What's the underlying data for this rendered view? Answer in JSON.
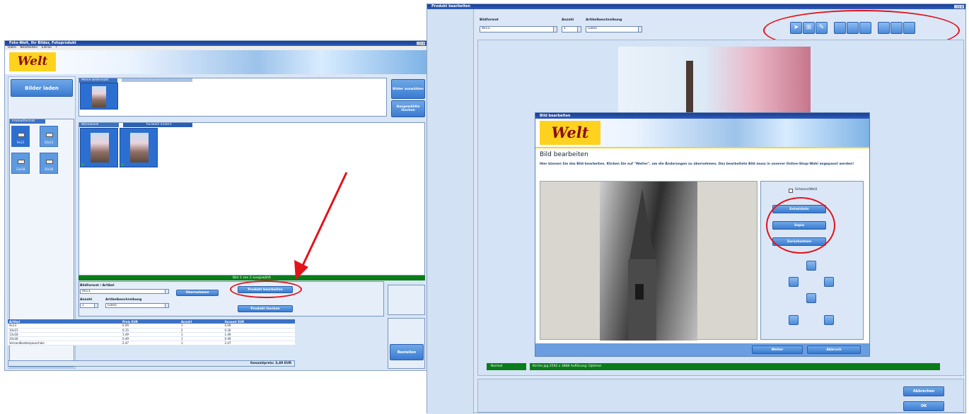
{
  "left_window": {
    "title": "Foto-Welt, Ihr Bilder, Fotoprodukt",
    "menu": [
      "Datei",
      "Bearbeiten",
      "Extras",
      "?"
    ],
    "logo": "Welt",
    "load_button": "Bilder laden",
    "top_panel": {
      "header": "Meine Bilderwahl",
      "tab": ""
    },
    "side_buttons": [
      "Bilder auswählen",
      "Ausgewählte löschen"
    ],
    "formats_header": "Produktformat",
    "formats": [
      "9x13",
      "10x15",
      "13x18",
      "20x30"
    ],
    "bottom_panel": {
      "header": "Warenkorb",
      "tab": "Auswahl ändern"
    },
    "green_bar": "Bild 2 von 2 ausgewählt",
    "labels": {
      "format": "Bildformat / Artikel",
      "count": "Anzahl",
      "description": "Artikelbeschreibung"
    },
    "format_value": "9x13",
    "count_value": "1",
    "description_value": "Glanz",
    "buttons": {
      "apply": "Übernehmen",
      "edit": "Produkt bearbeiten",
      "delete": "Produkt löschen",
      "order": "Bestellen"
    },
    "table": {
      "headers": [
        "Artikel",
        "Preis EUR",
        "Anzahl",
        "Gesamt EUR"
      ],
      "rows": [
        [
          "9x13",
          "0.09",
          "1",
          "0.09"
        ],
        [
          "10x15",
          "0.15",
          "2",
          "0.30"
        ],
        [
          "13x18",
          "1.49",
          "1",
          "1.49"
        ],
        [
          "20x30",
          "0.49",
          "1",
          "0.49"
        ],
        [
          "Versandkostenpauschale",
          "2.47",
          "1",
          "2.47"
        ]
      ],
      "total": "Gesamtpreis: 3,49 EUR"
    }
  },
  "right_window": {
    "title": "Produkt bearbeiten",
    "labels": {
      "format": "Bildformat",
      "count": "Anzahl",
      "description": "Artikelbeschreibung"
    },
    "format_value": "9x13",
    "count_value": "1",
    "description_value": "Glanz",
    "dialog": {
      "title": "Bild bearbeiten",
      "logo": "Welt",
      "heading": "Bild bearbeiten",
      "description": "Hier können Sie das Bild bearbeiten. Klicken Sie auf \"Weiter\", um die Änderungen zu übernehmen. Das bearbeitete Bild muss in unserer Online-Shop-Wahl angepasst werden!",
      "checkbox_label": "Schwarz/Weiß",
      "buttons": [
        "Entwickeln",
        "Sepia",
        "Zurücksetzen"
      ],
      "ok": "Weiter",
      "cancel": "Abbruch"
    },
    "status": {
      "mode": "Normal",
      "info": "Kirche.jpg 2592 x 3888 Auflösung: Optimal"
    },
    "buttons": {
      "cancel": "Abbrechen",
      "ok": "OK"
    }
  },
  "colors": {
    "accent": "#3c71c4",
    "green": "#0a7d1a",
    "highlight": "#e2131b",
    "logo": "#ffd21f"
  }
}
